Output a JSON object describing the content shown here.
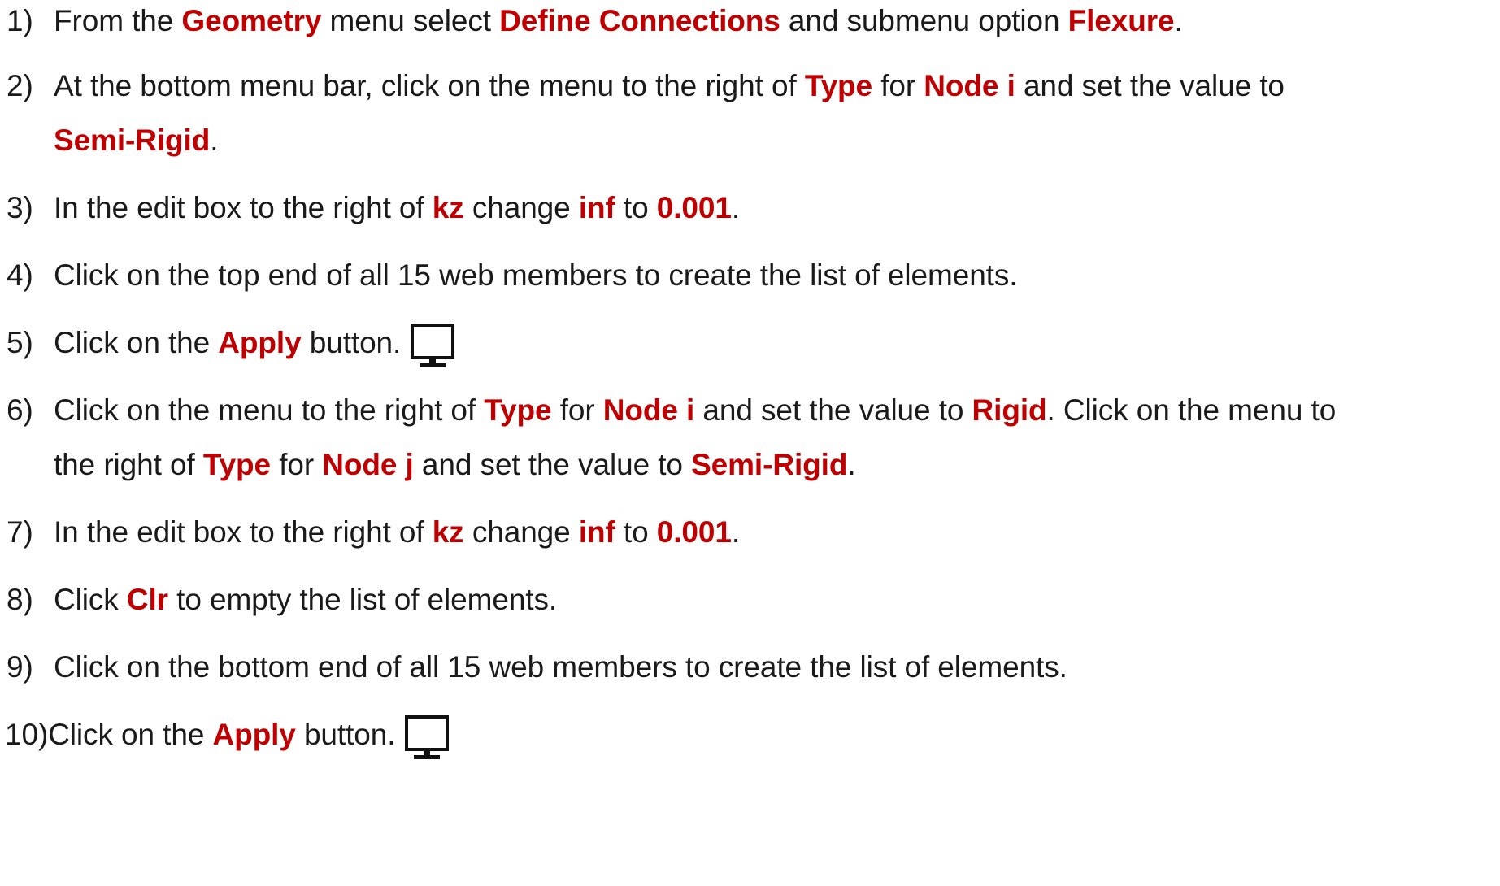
{
  "steps": [
    {
      "number": "1)",
      "lines": [
        [
          {
            "t": "From the "
          },
          {
            "t": "Geometry",
            "h": true
          },
          {
            "t": " menu select "
          },
          {
            "t": "Define Connections",
            "h": true
          },
          {
            "t": " and submenu option "
          },
          {
            "t": "Flexure",
            "h": true
          },
          {
            "t": "."
          }
        ]
      ]
    },
    {
      "number": "2)",
      "lines": [
        [
          {
            "t": "At the bottom menu bar, click on the menu to the right of "
          },
          {
            "t": "Type",
            "h": true
          },
          {
            "t": " for "
          },
          {
            "t": "Node i",
            "h": true
          },
          {
            "t": " and set the value to"
          }
        ],
        [
          {
            "t": "Semi-Rigid",
            "h": true
          },
          {
            "t": "."
          }
        ]
      ]
    },
    {
      "number": "3)",
      "lines": [
        [
          {
            "t": "In the edit box to the right of "
          },
          {
            "t": "kz",
            "h": true
          },
          {
            "t": " change "
          },
          {
            "t": "inf",
            "h": true
          },
          {
            "t": " to "
          },
          {
            "t": "0.001",
            "h": true
          },
          {
            "t": "."
          }
        ]
      ]
    },
    {
      "number": "4)",
      "lines": [
        [
          {
            "t": "Click on the top end of all 15 web members to create the list of elements."
          }
        ]
      ]
    },
    {
      "number": "5)",
      "icon": "monitor-icon",
      "lines": [
        [
          {
            "t": "Click on the "
          },
          {
            "t": "Apply",
            "h": true
          },
          {
            "t": " button."
          }
        ]
      ]
    },
    {
      "number": "6)",
      "lines": [
        [
          {
            "t": "Click on the menu to the right of "
          },
          {
            "t": "Type",
            "h": true
          },
          {
            "t": " for "
          },
          {
            "t": "Node i",
            "h": true
          },
          {
            "t": " and set the value to "
          },
          {
            "t": "Rigid",
            "h": true
          },
          {
            "t": ". Click on the menu to"
          }
        ],
        [
          {
            "t": "the right of "
          },
          {
            "t": "Type",
            "h": true
          },
          {
            "t": " for "
          },
          {
            "t": "Node j",
            "h": true
          },
          {
            "t": " and set the value to "
          },
          {
            "t": "Semi-Rigid",
            "h": true
          },
          {
            "t": "."
          }
        ]
      ]
    },
    {
      "number": "7)",
      "lines": [
        [
          {
            "t": "In the edit box to the right of "
          },
          {
            "t": "kz",
            "h": true
          },
          {
            "t": " change "
          },
          {
            "t": "inf",
            "h": true
          },
          {
            "t": " to "
          },
          {
            "t": "0.001",
            "h": true
          },
          {
            "t": "."
          }
        ]
      ]
    },
    {
      "number": "8)",
      "lines": [
        [
          {
            "t": "Click "
          },
          {
            "t": "Clr",
            "h": true
          },
          {
            "t": " to empty the list of elements."
          }
        ]
      ]
    },
    {
      "number": "9)",
      "lines": [
        [
          {
            "t": "Click on the bottom end of all 15 web members to create the list of elements."
          }
        ]
      ]
    },
    {
      "number": "10)",
      "icon": "monitor-icon",
      "lines": [
        [
          {
            "t": "Click on the "
          },
          {
            "t": "Apply",
            "h": true
          },
          {
            "t": " button."
          }
        ]
      ]
    }
  ],
  "colors": {
    "highlight": "#c00000",
    "text": "#1a1a1a"
  }
}
